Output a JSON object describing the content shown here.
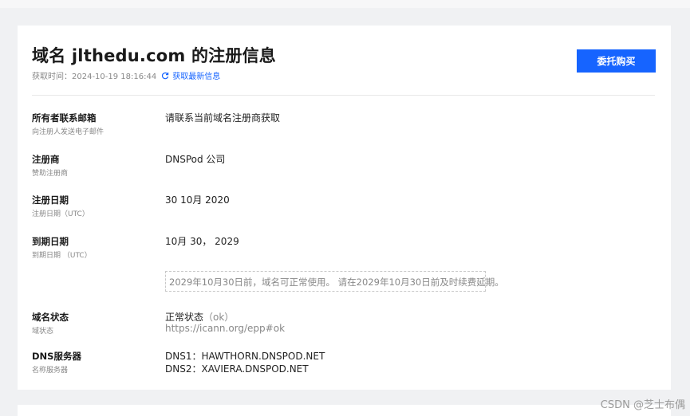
{
  "header": {
    "title": "域名 jlthedu.com 的注册信息",
    "fetch_time": "获取时间：2024-10-19 18:16:44",
    "refresh_label": "获取最新信息",
    "entrust_button": "委托购买"
  },
  "rows": [
    {
      "label": "所有者联系邮箱",
      "sublabel": "向注册人发送电子邮件",
      "value": "请联系当前域名注册商获取"
    },
    {
      "label": "注册商",
      "sublabel": "赞助注册商",
      "value": "DNSPod 公司"
    },
    {
      "label": "注册日期",
      "sublabel": "注册日期（UTC）",
      "value": "30 10月 2020"
    },
    {
      "label": "到期日期",
      "sublabel": "到期日期 （UTC）",
      "value": "10月 30， 2029"
    },
    {
      "label": "域名状态",
      "sublabel": "域状态",
      "value": "正常状态",
      "value_note": "（ok）",
      "value2": "https://icann.org/epp#ok"
    },
    {
      "label": "DNS服务器",
      "sublabel": "名称服务器",
      "value": "DNS1：HAWTHORN.DNSPOD.NET",
      "value2": "DNS2：XAVIERA.DNSPOD.NET"
    }
  ],
  "notice": "2029年10月30日前，域名可正常使用。 请在2029年10月30日前及时续费延期。",
  "watermark": "CSDN @芝士布偶",
  "colors": {
    "accent": "#1664ff",
    "muted": "#888888",
    "background": "#f0f1f3"
  },
  "icons": {
    "refresh": "refresh-icon"
  }
}
